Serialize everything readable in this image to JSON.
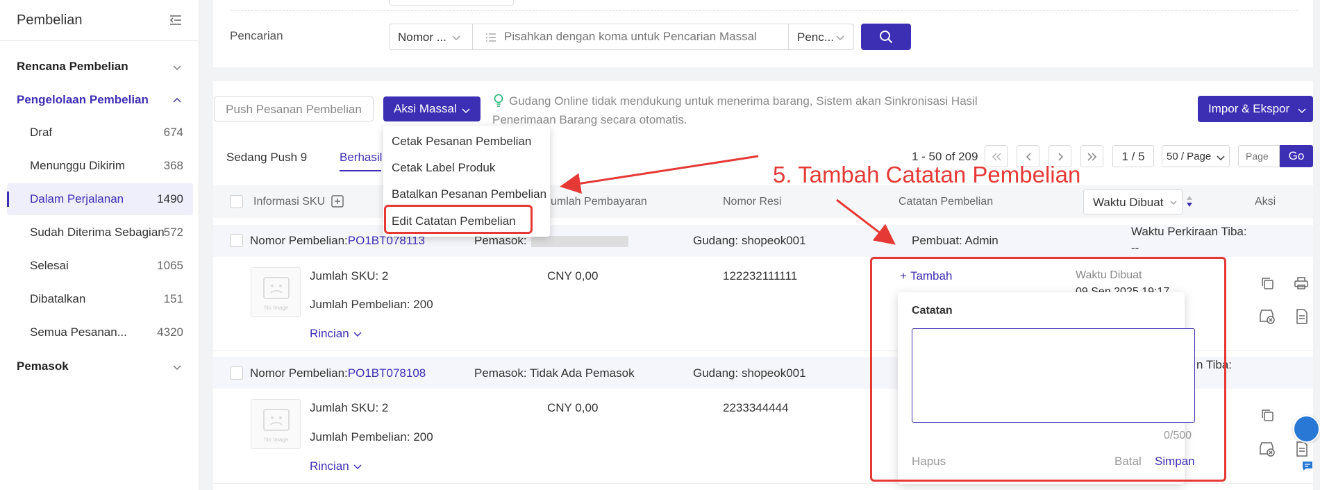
{
  "sidebar": {
    "title": "Pembelian",
    "groups": [
      {
        "label": "Rencana Pembelian"
      },
      {
        "label": "Pengelolaan Pembelian"
      },
      {
        "label": "Pemasok"
      }
    ],
    "items": [
      {
        "label": "Draf",
        "count": "674"
      },
      {
        "label": "Menunggu Dikirim",
        "count": "368"
      },
      {
        "label": "Dalam Perjalanan",
        "count": "1490"
      },
      {
        "label": "Sudah Diterima Sebagian",
        "count": "572"
      },
      {
        "label": "Selesai",
        "count": "1065"
      },
      {
        "label": "Dibatalkan",
        "count": "151"
      },
      {
        "label": "Semua Pesanan...",
        "count": "4320"
      }
    ]
  },
  "search": {
    "label": "Pencarian",
    "field_select": "Nomor ...",
    "placeholder": "Pisahkan dengan koma untuk Pencarian Massal",
    "mode_select": "Penc..."
  },
  "toolbar": {
    "push_label": "Push Pesanan Pembelian",
    "bulk_label": "Aksi Massal",
    "hint": "Gudang Online tidak mendukung untuk menerima barang, Sistem akan Sinkronisasi Hasil Penerimaan Barang secara otomatis.",
    "import_export_label": "Impor & Ekspor"
  },
  "bulk_menu": [
    {
      "label": "Cetak Pesanan Pembelian"
    },
    {
      "label": "Cetak Label Produk"
    },
    {
      "label": "Batalkan Pesanan Pembelian"
    },
    {
      "label": "Edit Catatan Pembelian"
    }
  ],
  "tabs": [
    {
      "label": "Sedang Push 9"
    },
    {
      "label": "Berhasil"
    }
  ],
  "pagination": {
    "range": "1 - 50 of 209",
    "page": "1 / 5",
    "page_size": "50 / Page",
    "page_placeholder": "Page",
    "go_label": "Go"
  },
  "table": {
    "headers": {
      "sku_info": "Informasi SKU",
      "payment": "Jumlah Pembayaran",
      "tracking": "Nomor Resi",
      "notes": "Catatan Pembelian",
      "sort": "Waktu Dibuat",
      "action": "Aksi"
    },
    "orders": [
      {
        "po_label": "Nomor Pembelian:",
        "po_number": "PO1BT078113",
        "supplier": "Pemasok:",
        "warehouse": "Gudang: shopeok001",
        "creator": "Pembuat: Admin",
        "eta_label": "Waktu Perkiraan Tiba:",
        "eta_value": "--",
        "sku_count": "Jumlah SKU: 2",
        "qty": "Jumlah Pembelian: 200",
        "detail": "Rincian",
        "amount": "CNY 0,00",
        "tracking": "122232111111",
        "add_note": "Tambah",
        "created_label": "Waktu Dibuat",
        "created_value": "09 Sep 2025 19:17"
      },
      {
        "po_label": "Nomor Pembelian:",
        "po_number": "PO1BT078108",
        "supplier": "Pemasok: Tidak Ada Pemasok",
        "warehouse": "Gudang: shopeok001",
        "eta_label": "n Tiba:",
        "sku_count": "Jumlah SKU: 2",
        "qty": "Jumlah Pembelian: 200",
        "detail": "Rincian",
        "amount": "CNY 0,00",
        "tracking": "2233344444"
      }
    ],
    "thumb_text": "No Image"
  },
  "note_popover": {
    "title": "Catatan",
    "counter": "0/500",
    "delete_label": "Hapus",
    "cancel_label": "Batal",
    "save_label": "Simpan"
  },
  "annotation": {
    "text": "5. Tambah Catatan Pembelian",
    "color": "#e53935"
  },
  "colors": {
    "primary": "#3d2fb4",
    "annotation": "#e53935"
  }
}
